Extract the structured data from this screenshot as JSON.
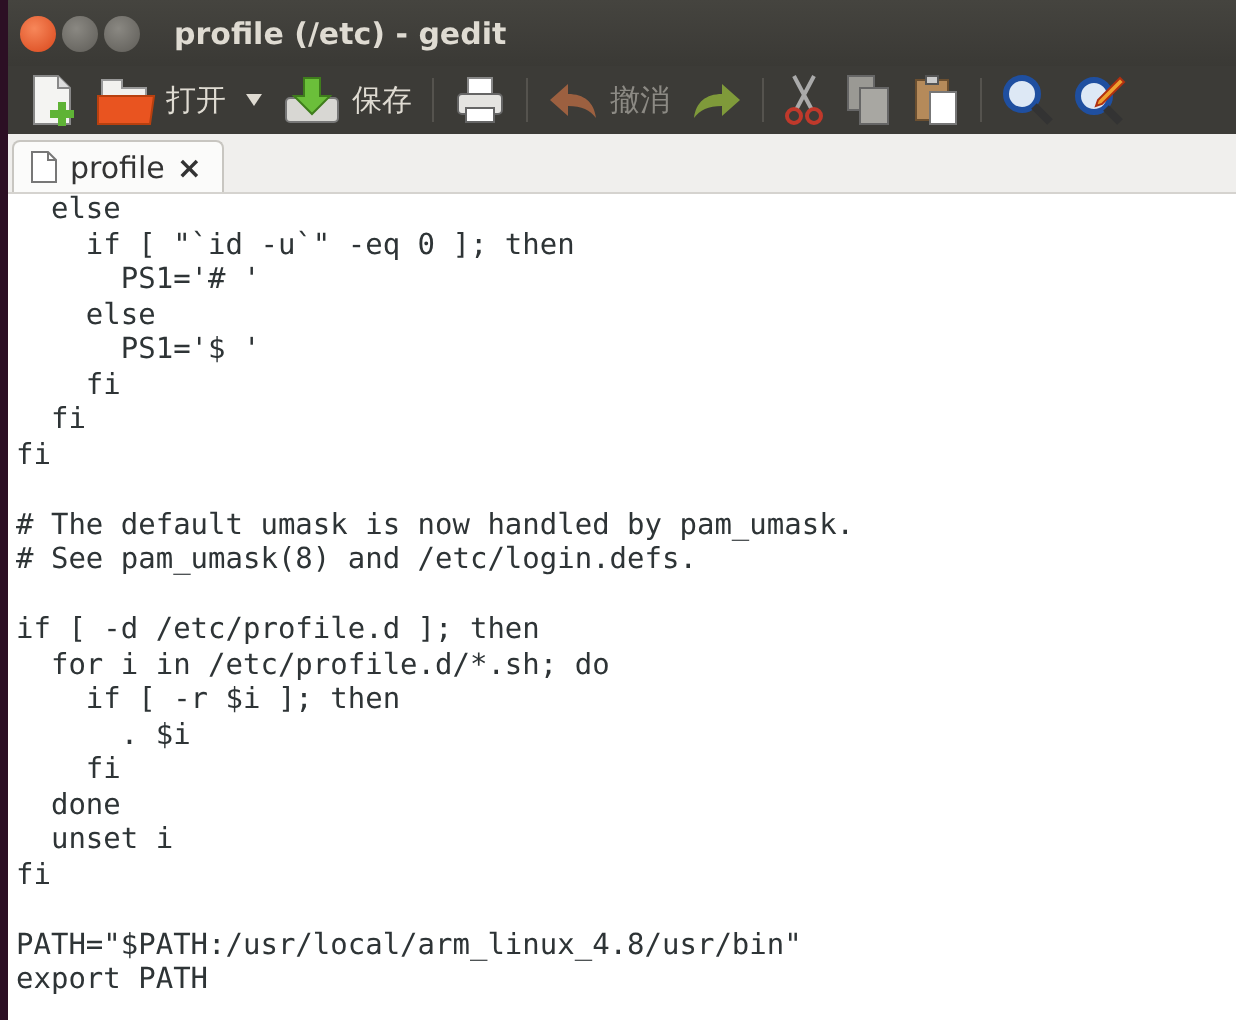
{
  "window": {
    "title": "profile (/etc) - gedit"
  },
  "toolbar": [
    {
      "kind": "new",
      "disabled": false
    },
    {
      "kind": "open",
      "label": "打开",
      "disabled": false
    },
    {
      "kind": "dropdown",
      "disabled": false
    },
    {
      "kind": "save",
      "label": "保存",
      "disabled": false
    },
    {
      "kind": "sep"
    },
    {
      "kind": "print",
      "disabled": false
    },
    {
      "kind": "sep"
    },
    {
      "kind": "undo",
      "label": "撤消",
      "disabled": true
    },
    {
      "kind": "redo",
      "disabled": false
    },
    {
      "kind": "sep"
    },
    {
      "kind": "cut",
      "disabled": false
    },
    {
      "kind": "copy",
      "disabled": false
    },
    {
      "kind": "paste",
      "disabled": false
    },
    {
      "kind": "sep"
    },
    {
      "kind": "find",
      "disabled": false
    },
    {
      "kind": "replace",
      "disabled": false
    }
  ],
  "tabs": [
    {
      "label": "profile",
      "close": "×",
      "selected": true
    }
  ],
  "editor": {
    "blocks": [
      [
        "  else",
        "    if [ \"`id -u`\" -eq 0 ]; then",
        "      PS1='# '",
        "    else",
        "      PS1='$ '",
        "    fi",
        "  fi",
        "fi"
      ],
      [
        "# The default umask is now handled by pam_umask.",
        "# See pam_umask(8) and /etc/login.defs."
      ],
      [
        "if [ -d /etc/profile.d ]; then",
        "  for i in /etc/profile.d/*.sh; do",
        "    if [ -r $i ]; then",
        "      . $i",
        "    fi",
        "  done",
        "  unset i",
        "fi"
      ],
      [
        "PATH=\"$PATH:/usr/local/arm_linux_4.8/usr/bin\"",
        "export PATH"
      ]
    ]
  }
}
